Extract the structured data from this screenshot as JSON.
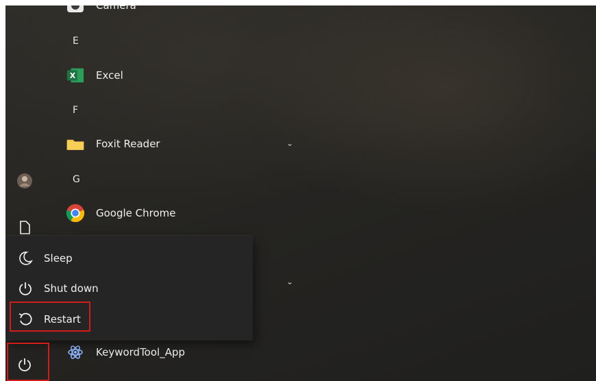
{
  "apps": {
    "camera_label": "Camera",
    "letter_e": "E",
    "excel_label": "Excel",
    "letter_f": "F",
    "foxit_label": "Foxit Reader",
    "letter_g": "G",
    "chrome_label": "Google Chrome",
    "keywordtool_label": "KeywordTool_App",
    "excel_icon_text": "X"
  },
  "power_menu": {
    "sleep_label": "Sleep",
    "shutdown_label": "Shut down",
    "restart_label": "Restart"
  },
  "colors": {
    "highlight": "#d21c1c",
    "excel_green": "#1f7244",
    "folder_yellow": "#f5c242",
    "menu_bg": "#252525"
  },
  "icons": {
    "camera": "camera-icon",
    "excel": "excel-icon",
    "folder": "folder-icon",
    "chrome": "chrome-icon",
    "keywordtool": "keywordtool-icon",
    "avatar": "avatar",
    "document": "document-icon",
    "power": "power-icon",
    "sleep": "moon-icon",
    "shutdown": "power-icon",
    "restart": "restart-icon",
    "chevron": "chevron-down-icon"
  }
}
